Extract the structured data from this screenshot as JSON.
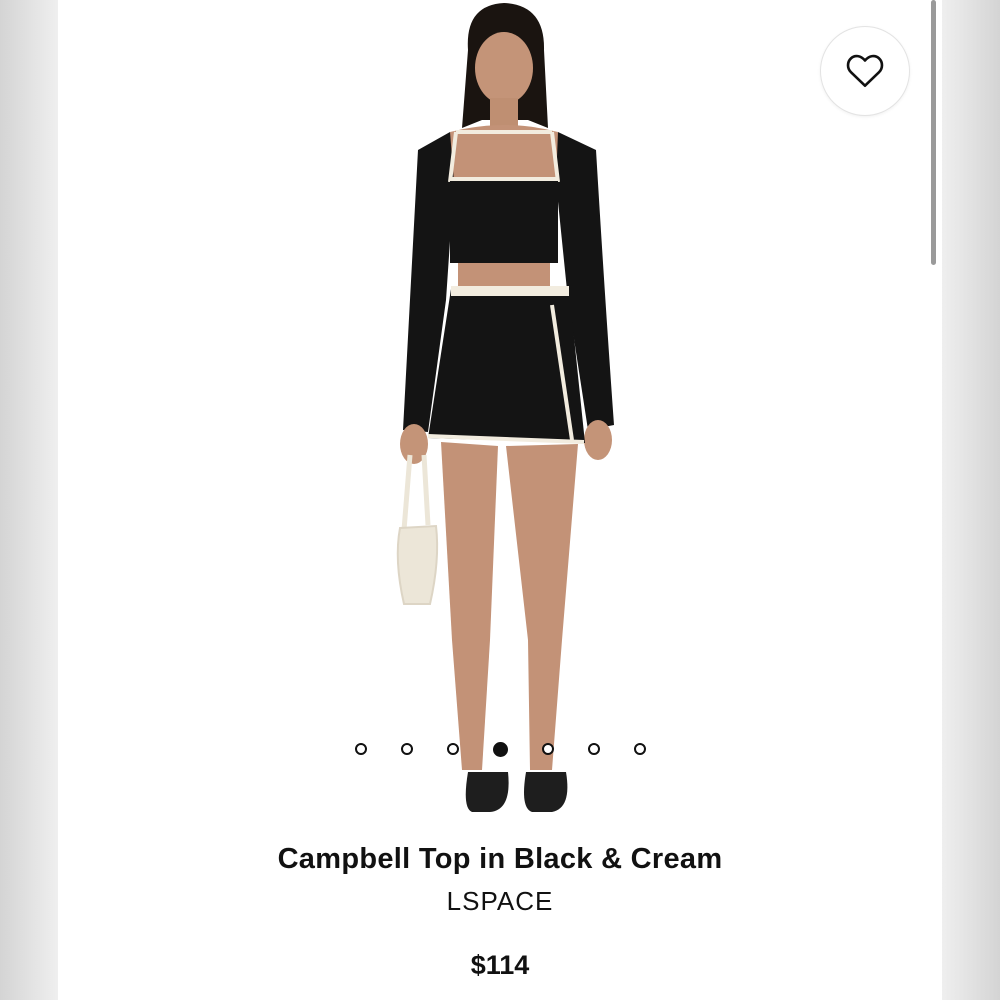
{
  "product": {
    "title": "Campbell Top in Black & Cream",
    "brand": "LSPACE",
    "price": "$114"
  },
  "gallery": {
    "total_images": 7,
    "active_index": 4
  },
  "icons": {
    "favorite": "heart-outline-icon"
  },
  "colors": {
    "garment_primary": "#141414",
    "garment_trim": "#f2ecdf",
    "text": "#111111"
  }
}
